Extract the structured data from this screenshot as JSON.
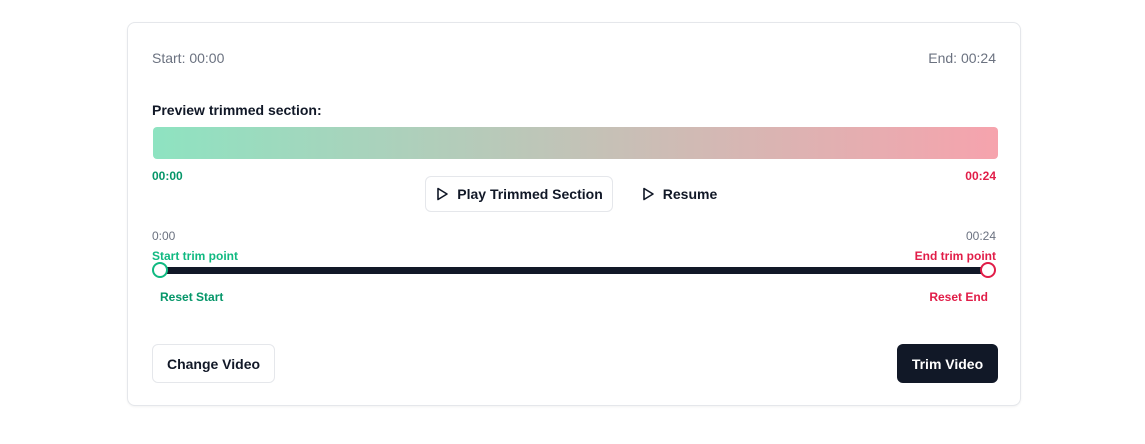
{
  "times": {
    "start_label": "Start: 00:00",
    "end_label": "End: 00:24"
  },
  "preview": {
    "title": "Preview trimmed section:",
    "start_time": "00:00",
    "end_time": "00:24",
    "gradient_start_color": "#8ee3c1",
    "gradient_end_color": "#f6a3ad"
  },
  "controls": {
    "play_trimmed_label": "Play Trimmed Section",
    "resume_label": "Resume",
    "play_icon": "play-icon"
  },
  "slider": {
    "axis_start": "0:00",
    "axis_end": "00:24",
    "start_trim_label": "Start trim point",
    "end_trim_label": "End trim point",
    "start_fraction": 0,
    "end_fraction": 1,
    "reset_start_label": "Reset Start",
    "reset_end_label": "Reset End"
  },
  "actions": {
    "change_video_label": "Change Video",
    "trim_video_label": "Trim Video"
  },
  "colors": {
    "accent_green": "#10b981",
    "accent_red": "#e11d48",
    "primary_dark": "#111827"
  }
}
